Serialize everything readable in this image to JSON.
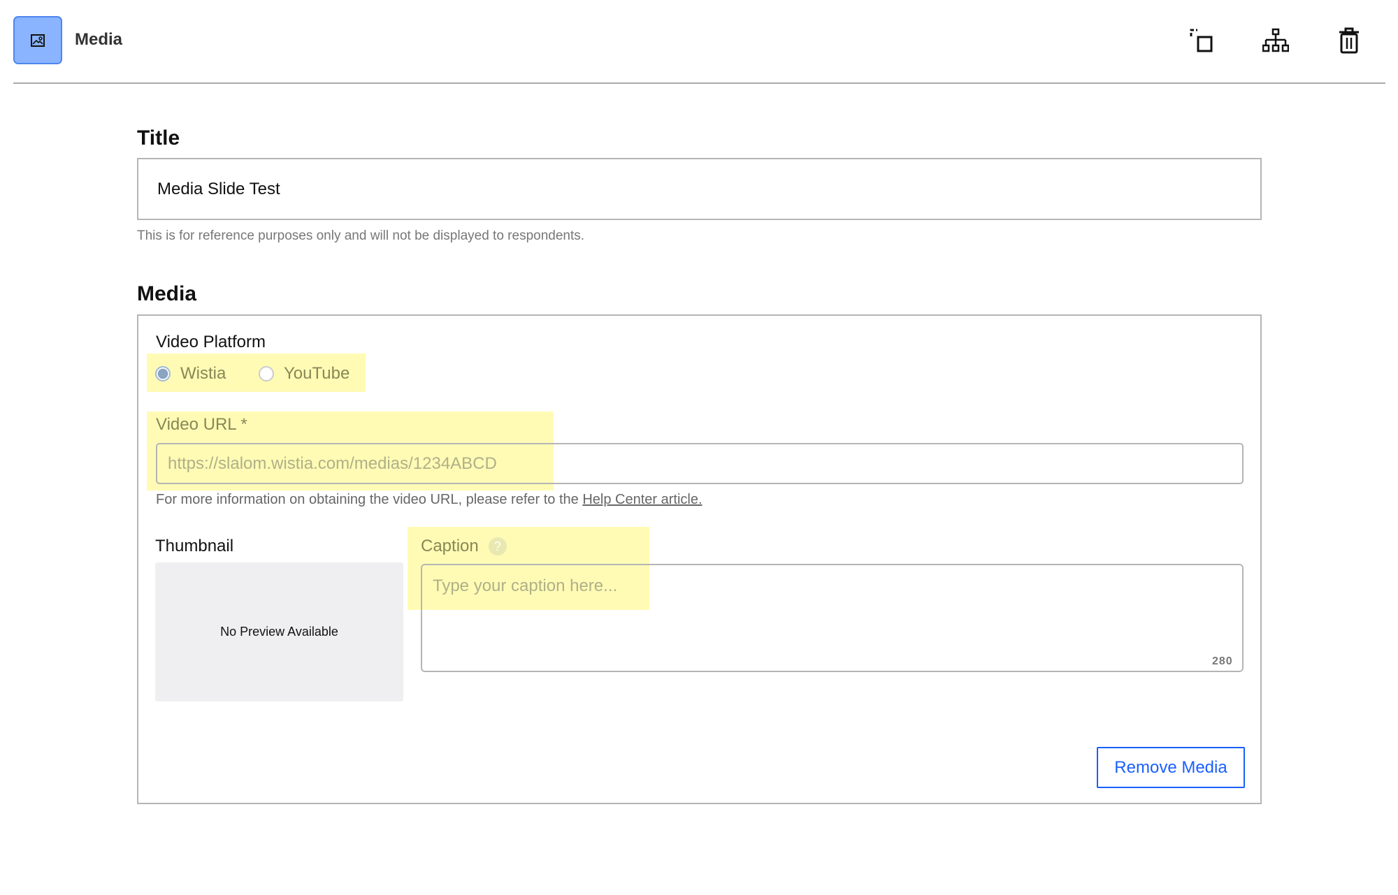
{
  "header": {
    "title": "Media",
    "icon": "image-icon",
    "tools": [
      "duplicate-icon",
      "sitemap-icon",
      "trash-icon"
    ]
  },
  "title_section": {
    "label": "Title",
    "value": "Media Slide Test",
    "helper": "This is for reference purposes only and will not be displayed to respondents."
  },
  "media_section": {
    "label": "Media",
    "platform": {
      "label": "Video Platform",
      "options": [
        "Wistia",
        "YouTube"
      ],
      "selected": "Wistia"
    },
    "video_url": {
      "label": "Video URL *",
      "placeholder": "https://slalom.wistia.com/medias/1234ABCD",
      "helper": "For more information on obtaining the video URL, please refer to the ",
      "help_link": "Help Center article."
    },
    "thumbnail": {
      "label": "Thumbnail",
      "empty_text": "No Preview Available"
    },
    "caption": {
      "label": "Caption",
      "placeholder": "Type your caption here...",
      "counter": "280"
    },
    "remove_button": "Remove Media"
  },
  "colors": {
    "accent": "#1a5fff",
    "header_icon_bg": "#8ab4ff",
    "highlight": "#fffbb5"
  }
}
